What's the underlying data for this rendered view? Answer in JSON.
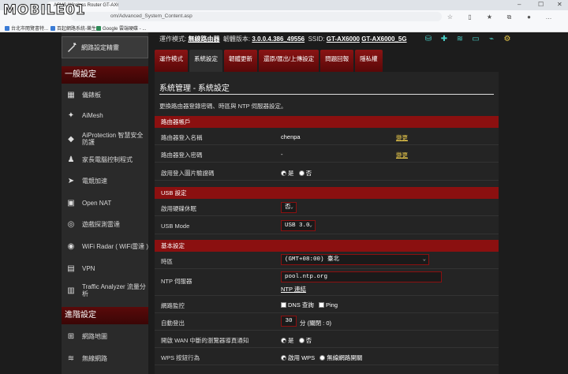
{
  "watermark": "MOBILE01",
  "browser": {
    "tab_title": "ASUS Wireless Router GT-AX6000",
    "url": "om/Advanced_System_Content.asp",
    "favorites": [
      "台北市閱覽書特...",
      "百起網路系統-樂生...",
      "Google 雲端硬碟 - ..."
    ]
  },
  "status": {
    "mode_label": "運作模式:",
    "mode_value": "無線路由器",
    "fw_label": "韌體版本:",
    "fw_value": "3.0.0.4.386_49556",
    "ssid_label": "SSID:",
    "ssid_1": "GT-AX6000",
    "ssid_2": "GT-AX6000_5G"
  },
  "sidebar": {
    "wizard": "網路設定精靈",
    "general_head": "一般設定",
    "general_items": [
      "儀錶板",
      "AiMesh",
      "AiProtection 智慧安全防護",
      "家長電腦控制程式",
      "電競加速",
      "Open NAT",
      "遊戲探測雷達",
      "WiFi Radar ( WiFi雷達 )",
      "VPN",
      "Traffic Analyzer 流量分析"
    ],
    "advanced_head": "進階設定",
    "advanced_items": [
      "網路地圖",
      "無線網路"
    ]
  },
  "tabs": [
    "運作模式",
    "系統設定",
    "韌體更新",
    "還原/匯出/上傳設定",
    "問題回報",
    "隱私權"
  ],
  "panel": {
    "title": "系統管理 - 系統設定",
    "desc": "更換路由器登錄密碼、時區與 NTP 伺服器設定。",
    "sec_account": "路由器帳戶",
    "login_name_label": "路由器登入名稱",
    "login_name_value": "chenpa",
    "login_pw_label": "路由器登入密碼",
    "login_pw_value": "-",
    "change_link": "變更",
    "captcha_label": "啟用登入圖片驗證碼",
    "yes": "是",
    "no": "否",
    "sec_usb": "USB 設定",
    "hdd_sleep_label": "啟用硬碟休眠",
    "hdd_sleep_value": "否",
    "usb_mode_label": "USB Mode",
    "usb_mode_value": "USB 3.0",
    "sec_basic": "基本設定",
    "tz_label": "時區",
    "tz_value": "(GMT+08:00) 臺北",
    "ntp_label": "NTP 伺服器",
    "ntp_value": "pool.ntp.org",
    "ntp_link": "NTP 連結",
    "netmon_label": "網路監控",
    "dns_query": "DNS 查詢",
    "ping": "Ping",
    "autologout_label": "自動登出",
    "autologout_value": "30",
    "autologout_unit": "分 (關閉 : 0)",
    "wan_notify_label": "開啟 WAN 中斷的瀏覽器導頁通知",
    "wps_label": "WPS 按鈕行為",
    "wps_opt1": "啟用 WPS",
    "wps_opt2": "無線網路開關"
  }
}
